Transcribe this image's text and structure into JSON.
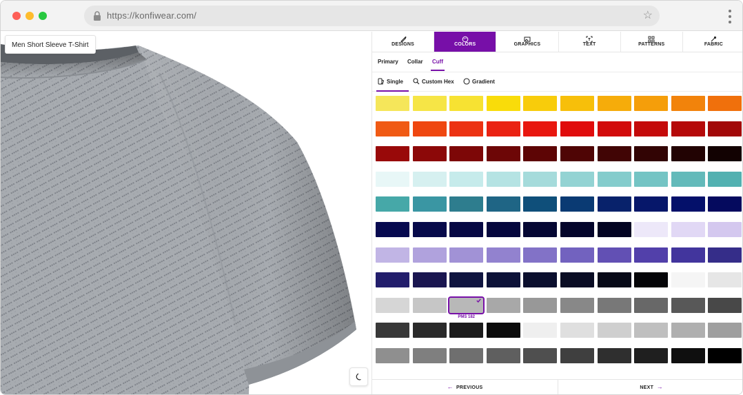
{
  "browser": {
    "url": "https://konfiwear.com/"
  },
  "viewer": {
    "product_name": "Men Short Sleeve T-Shirt",
    "shirt_color": "#a4a8ad"
  },
  "tabs": [
    {
      "label": "DESIGNS",
      "icon": "brush-icon",
      "active": false
    },
    {
      "label": "COLORS",
      "icon": "palette-icon",
      "active": true
    },
    {
      "label": "GRAPHICS",
      "icon": "image-icon",
      "active": false
    },
    {
      "label": "TEXT",
      "icon": "text-icon",
      "active": false
    },
    {
      "label": "PATTERNS",
      "icon": "grid-icon",
      "active": false
    },
    {
      "label": "FABRIC",
      "icon": "needle-icon",
      "active": false
    }
  ],
  "subtabs": [
    {
      "label": "Primary",
      "active": false
    },
    {
      "label": "Collar",
      "active": false
    },
    {
      "label": "Cuff",
      "active": true
    }
  ],
  "modes": [
    {
      "label": "Single",
      "icon": "swatch-icon",
      "active": true
    },
    {
      "label": "Custom Hex",
      "icon": "search-icon",
      "active": false
    },
    {
      "label": "Gradient",
      "icon": "circle-icon",
      "active": false
    }
  ],
  "palette": {
    "selected_row": 8,
    "selected_col": 2,
    "selected_label": "PMS 182",
    "accent": "#770fa8",
    "rows": [
      [
        "#f5e65a",
        "#f6e546",
        "#f7e232",
        "#f9dc0a",
        "#f8cc0b",
        "#f7bf0a",
        "#f6ac0a",
        "#f59e0a",
        "#f2830b",
        "#f0700c"
      ],
      [
        "#f05a14",
        "#ef4710",
        "#ec3212",
        "#ea2212",
        "#e8170f",
        "#e00c0c",
        "#d20b0b",
        "#c40a0a",
        "#b50909",
        "#a20808"
      ],
      [
        "#990909",
        "#8c0808",
        "#7d0707",
        "#6d0606",
        "#5d0505",
        "#4f0505",
        "#410505",
        "#320404",
        "#220303",
        "#120202"
      ],
      [
        "#e8f7f7",
        "#d6f0f0",
        "#c6ebeb",
        "#b5e3e3",
        "#a5dbdb",
        "#93d3d3",
        "#84cccc",
        "#74c4c4",
        "#63baba",
        "#52b1b1"
      ],
      [
        "#46a8a8",
        "#3a96a3",
        "#2e7d8e",
        "#1f6585",
        "#0f4f7a",
        "#0a3a73",
        "#08226b",
        "#06176a",
        "#04106a",
        "#050a5e"
      ],
      [
        "#06094f",
        "#070a4a",
        "#060843",
        "#05073d",
        "#050733",
        "#04052b",
        "#030422",
        "#ede8f9",
        "#e1d8f5",
        "#d4c8ef"
      ],
      [
        "#c1b5e5",
        "#b0a2dd",
        "#a192d6",
        "#9282cf",
        "#8272c7",
        "#7262bf",
        "#6250b4",
        "#5240aa",
        "#42359d",
        "#352d89"
      ],
      [
        "#221d6b",
        "#1a1650",
        "#101540",
        "#0d1238",
        "#0b0f2e",
        "#0a0d24",
        "#080a18",
        "#050508",
        "#f5f5f5",
        "#e6e6e6"
      ],
      [
        "#d6d6d6",
        "#c6c6c6",
        "#b8b8b8",
        "#a8a8a8",
        "#989898",
        "#888888",
        "#787878",
        "#686868",
        "#585858",
        "#484848"
      ],
      [
        "#383838",
        "#2a2a2a",
        "#1c1c1c",
        "#0c0c0c",
        "#efefef",
        "#dfdfdf",
        "#cfcfcf",
        "#bfbfbf",
        "#afafaf",
        "#9f9f9f"
      ],
      [
        "#8f8f8f",
        "#7f7f7f",
        "#6f6f6f",
        "#5f5f5f",
        "#4f4f4f",
        "#3f3f3f",
        "#2f2f2f",
        "#1f1f1f",
        "#0f0f0f",
        "#000000"
      ]
    ]
  },
  "footer": {
    "prev_label": "PREVIOUS",
    "next_label": "NEXT"
  }
}
